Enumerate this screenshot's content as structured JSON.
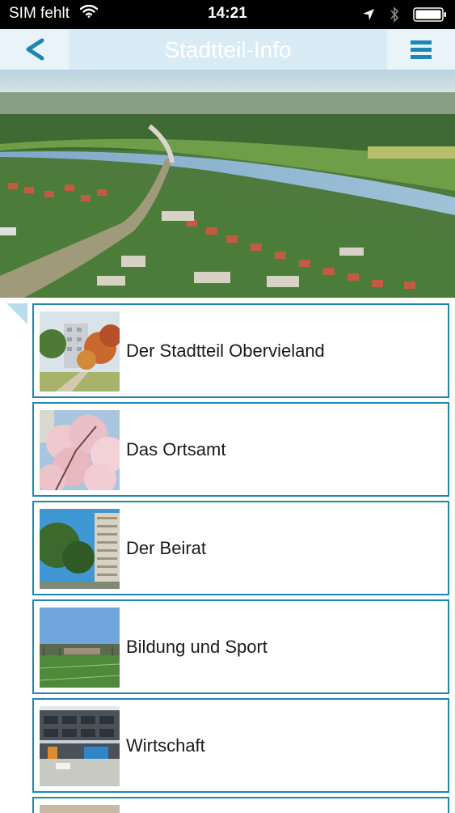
{
  "status_bar": {
    "carrier": "SIM fehlt",
    "time": "14:21",
    "icons": [
      "wifi-icon",
      "location-arrow-icon",
      "bluetooth-icon",
      "battery-icon"
    ]
  },
  "nav": {
    "back_label": "<",
    "title": "Stadtteil-Info",
    "menu_icon": "hamburger-menu-icon"
  },
  "hero": {
    "description_icon": "aerial-city-photo"
  },
  "items": [
    {
      "label": "Der Stadtteil Obervieland",
      "thumb_icon": "autumn-building-photo"
    },
    {
      "label": "Das Ortsamt",
      "thumb_icon": "cherry-blossom-photo"
    },
    {
      "label": "Der Beirat",
      "thumb_icon": "tall-building-photo"
    },
    {
      "label": "Bildung und Sport",
      "thumb_icon": "sports-field-photo"
    },
    {
      "label": "Wirtschaft",
      "thumb_icon": "commercial-building-photo"
    }
  ],
  "colors": {
    "accent": "#1d86b2",
    "nav_bg": "#e6f1f7",
    "nav_title": "#ffffff"
  }
}
